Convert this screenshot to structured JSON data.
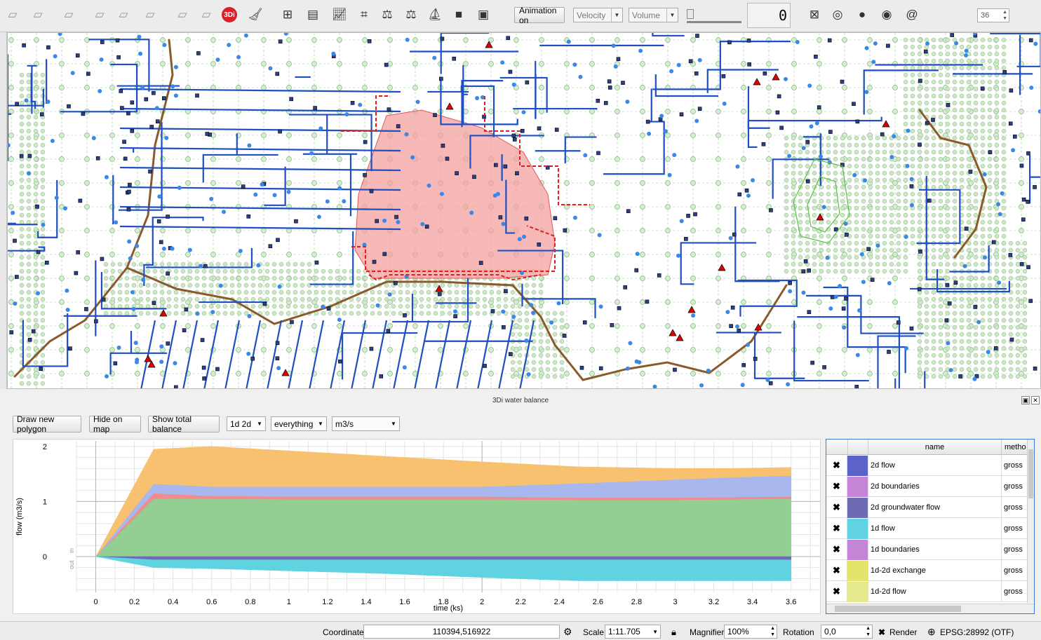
{
  "toolbar": {
    "animation_label": "Animation on",
    "velocity_placeholder": "Velocity",
    "volume_placeholder": "Volume",
    "slider_value": "0",
    "spin_value": "36",
    "icons": [
      "select-polygon-icon",
      "select-freehand-icon",
      "select-radius-icon",
      "select-location-icon",
      "deselect-icon",
      "identify-icon",
      "measure-icon",
      "statistics-icon",
      "threedi-icon",
      "clear-cache-icon",
      "add-results-icon",
      "sideview-icon",
      "graph-icon",
      "map-animation-icon",
      "water-balance-icon",
      "weighing-icon",
      "boundary-icon",
      "square-icon",
      "square-dot-icon",
      "square-cross-icon",
      "target-icon",
      "circle-icon",
      "circle-outline-icon",
      "spiral-icon"
    ]
  },
  "map": {
    "colors": {
      "pipes": "#1f4fc0",
      "flow_polygon": "#f4a0a0",
      "grid": "#7fb97f",
      "channels": "#8b5a2b",
      "markers": "#e00000"
    }
  },
  "water_balance": {
    "title": "3Di water balance",
    "buttons": {
      "draw": "Draw new polygon",
      "hide": "Hide on map",
      "total": "Show total balance"
    },
    "combos": {
      "mode": "1d 2d",
      "filter": "everything",
      "unit": "m3/s"
    },
    "legend": {
      "col_name": "name",
      "col_method": "metho",
      "rows": [
        {
          "name": "2d flow",
          "method": "gross",
          "color": "#5b63c9"
        },
        {
          "name": "2d boundaries",
          "method": "gross",
          "color": "#c585d6"
        },
        {
          "name": "2d groundwater flow",
          "method": "gross",
          "color": "#6f6bb3"
        },
        {
          "name": "1d flow",
          "method": "gross",
          "color": "#5fd3e0"
        },
        {
          "name": "1d boundaries",
          "method": "gross",
          "color": "#c585d6"
        },
        {
          "name": "1d-2d exchange",
          "method": "gross",
          "color": "#e2e56a"
        },
        {
          "name": "1d-2d flow",
          "method": "gross",
          "color": "#e5e98d"
        }
      ]
    },
    "in_label": "in",
    "out_label": "out"
  },
  "chart_data": {
    "type": "area",
    "xlabel": "time (ks)",
    "ylabel": "flow (m3/s)",
    "xlim": [
      -0.1,
      3.75
    ],
    "ylim": [
      -0.65,
      2.1
    ],
    "xticks": [
      0,
      0.2,
      0.4,
      0.6,
      0.8,
      1,
      1.2,
      1.4,
      1.6,
      1.8,
      2,
      2.2,
      2.4,
      2.6,
      2.8,
      3,
      3.2,
      3.4,
      3.6
    ],
    "yticks": [
      0,
      1,
      2
    ],
    "x": [
      0,
      0.3,
      0.6,
      1.0,
      1.5,
      2.0,
      2.5,
      3.0,
      3.3,
      3.6
    ],
    "series_pos": [
      {
        "color": "#93cf93",
        "values": [
          0,
          1.05,
          1.05,
          1.04,
          1.04,
          1.04,
          1.03,
          1.03,
          1.04,
          1.05
        ]
      },
      {
        "color": "#f28b8b",
        "values": [
          0,
          0.1,
          0.05,
          0.05,
          0.05,
          0.05,
          0.04,
          0.04,
          0.04,
          0.04
        ]
      },
      {
        "color": "#a8b8ee",
        "values": [
          0,
          0.17,
          0.17,
          0.18,
          0.18,
          0.18,
          0.26,
          0.33,
          0.36,
          0.38
        ]
      },
      {
        "color": "#f8c170",
        "values": [
          0,
          0.63,
          0.73,
          0.65,
          0.55,
          0.45,
          0.3,
          0.2,
          0.16,
          0.15
        ]
      }
    ],
    "series_neg": [
      {
        "color": "#6f6bb3",
        "values": [
          0,
          -0.06,
          -0.06,
          -0.06,
          -0.06,
          -0.06,
          -0.06,
          -0.06,
          -0.06,
          -0.06
        ]
      },
      {
        "color": "#5fd3e0",
        "values": [
          0,
          -0.14,
          -0.16,
          -0.2,
          -0.25,
          -0.32,
          -0.38,
          -0.38,
          -0.38,
          -0.38
        ]
      }
    ]
  },
  "status": {
    "coordinate_label": "Coordinate",
    "coordinate_value": "110394,516922",
    "scale_label": "Scale",
    "scale_value": "1:11.705",
    "magnifier_label": "Magnifier",
    "magnifier_value": "100%",
    "rotation_label": "Rotation",
    "rotation_value": "0,0",
    "render_label": "Render",
    "crs_label": "EPSG:28992 (OTF)"
  }
}
